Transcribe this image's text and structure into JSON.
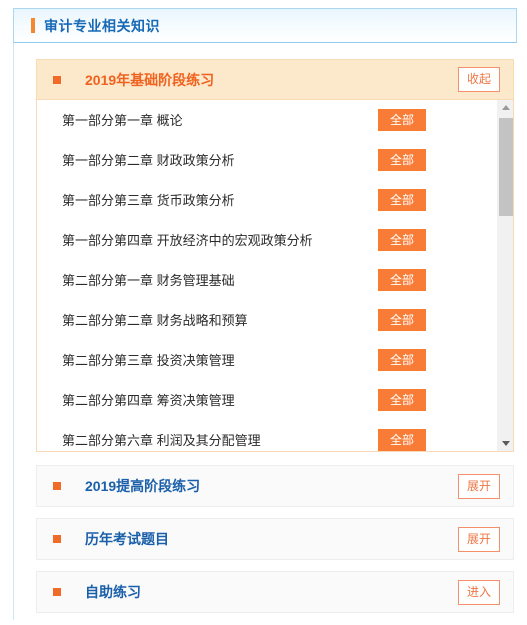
{
  "header": {
    "title": "审计专业相关知识",
    "accent_bar_color": "#f5872e",
    "title_color": "#1769b5"
  },
  "accordion": {
    "title": "2019年基础阶段练习",
    "toggle_label": "收起",
    "header_bg": "#fce8cb",
    "title_color": "#f0621e",
    "bullet_color": "#f06a28",
    "chapters": [
      {
        "name": "第一部分第一章  概论",
        "action": "全部"
      },
      {
        "name": "第一部分第二章  财政政策分析",
        "action": "全部"
      },
      {
        "name": "第一部分第三章  货币政策分析",
        "action": "全部"
      },
      {
        "name": "第一部分第四章  开放经济中的宏观政策分析",
        "action": "全部"
      },
      {
        "name": "第二部分第一章  财务管理基础",
        "action": "全部"
      },
      {
        "name": "第二部分第二章  财务战略和预算",
        "action": "全部"
      },
      {
        "name": "第二部分第三章  投资决策管理",
        "action": "全部"
      },
      {
        "name": "第二部分第四章  筹资决策管理",
        "action": "全部"
      },
      {
        "name": "第二部分第六章  利润及其分配管理",
        "action": "全部"
      }
    ],
    "action_button_color": "#f87b36",
    "scrollbar": {
      "thumb_color": "#c3c3c3",
      "track_color": "#f1f1f1"
    }
  },
  "sections": [
    {
      "title": "2019提高阶段练习",
      "action": "展开"
    },
    {
      "title": "历年考试题目",
      "action": "展开"
    },
    {
      "title": "自助练习",
      "action": "进入"
    }
  ]
}
